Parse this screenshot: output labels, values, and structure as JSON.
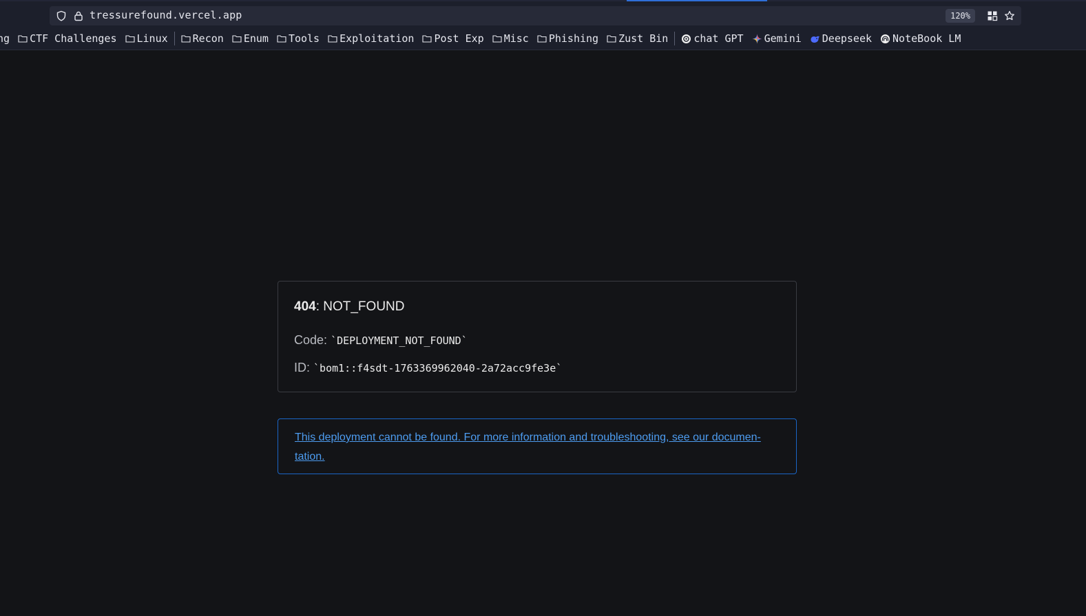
{
  "browser": {
    "url": "tressurefound.vercel.app",
    "zoom": "120%",
    "bookmarks": [
      {
        "label": "ng",
        "type": "folder-cut"
      },
      {
        "label": "CTF Challenges",
        "type": "folder"
      },
      {
        "label": "Linux",
        "type": "folder"
      },
      {
        "label": "Recon",
        "type": "folder"
      },
      {
        "label": "Enum",
        "type": "folder"
      },
      {
        "label": "Tools",
        "type": "folder"
      },
      {
        "label": "Exploitation",
        "type": "folder"
      },
      {
        "label": "Post Exp",
        "type": "folder"
      },
      {
        "label": "Misc",
        "type": "folder"
      },
      {
        "label": "Phishing",
        "type": "folder"
      },
      {
        "label": "Zust Bin",
        "type": "folder"
      },
      {
        "label": "chat GPT",
        "type": "site",
        "icon": "chatgpt-icon"
      },
      {
        "label": "Gemini",
        "type": "site",
        "icon": "gemini-icon"
      },
      {
        "label": "Deepseek",
        "type": "site",
        "icon": "deepseek-icon"
      },
      {
        "label": "NoteBook LM",
        "type": "site",
        "icon": "notebooklm-icon"
      }
    ]
  },
  "error": {
    "status_code": "404",
    "status_text": ": NOT_FOUND",
    "code_label": "Code:",
    "code_value": "`DEPLOYMENT_NOT_FOUND`",
    "id_label": "ID:",
    "id_value": "`bom1::f4sdt-1763369962040-2a72acc9fe3e`"
  },
  "info": {
    "message": "This deployment cannot be found. For more information and troubleshooting, see our documen-tation."
  },
  "colors": {
    "page_bg": "#131417",
    "link": "#4d9cf0",
    "info_border": "#1a66c7",
    "toolbar_bg": "#1c1f2b"
  }
}
